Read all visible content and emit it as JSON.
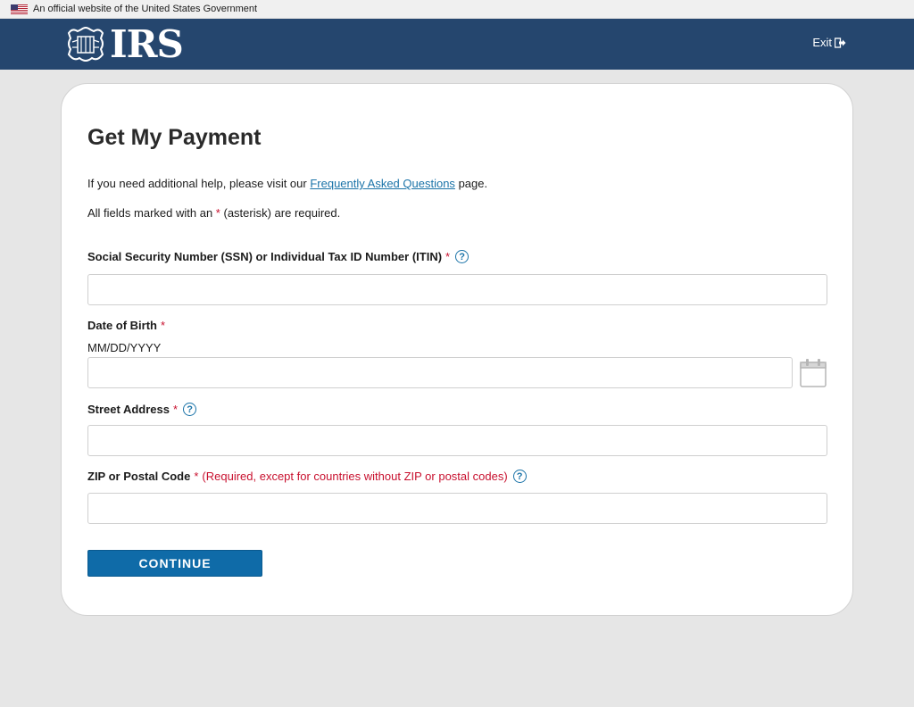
{
  "gov_banner": {
    "text": "An official website of the United States Government"
  },
  "header": {
    "logo_text": "IRS",
    "exit_label": "Exit",
    "brand_color": "#25466e"
  },
  "form": {
    "title": "Get My Payment",
    "help_prefix": "If you need additional help, please visit our",
    "help_link": "Frequently Asked Questions",
    "help_suffix": "page.",
    "required_prefix": "All fields marked with an",
    "required_star": "*",
    "required_suffix": "(asterisk) are required.",
    "fields": [
      {
        "label": "Social Security Number (SSN) or Individual Tax ID Number (ITIN)",
        "star": "*",
        "value": ""
      },
      {
        "label": "Date of Birth",
        "star": "*",
        "hint": "MM/DD/YYYY",
        "value": ""
      },
      {
        "label": "Street Address",
        "star": "*",
        "value": ""
      },
      {
        "label": "ZIP or Postal Code",
        "star": "*",
        "note": "(Required, except for countries without ZIP or postal codes)",
        "value": ""
      }
    ],
    "continue_label": "CONTINUE",
    "button_color": "#0f6ba8",
    "help_icon_glyph": "?"
  }
}
